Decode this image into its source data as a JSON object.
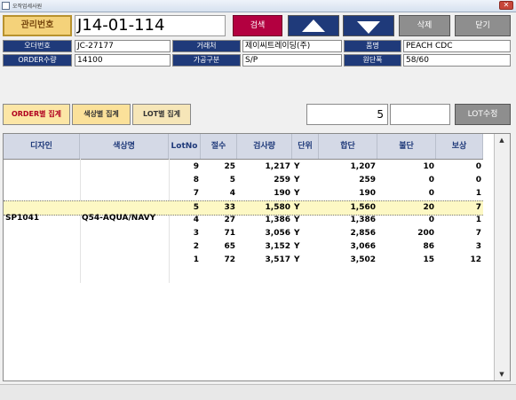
{
  "window": {
    "title": "오작업세사원"
  },
  "header": {
    "key_label": "관리번호",
    "key_value": "J14-01-114",
    "search_label": "검색",
    "delete_label": "삭제",
    "close_label": "닫기"
  },
  "fields": {
    "order_no_label": "오더번호",
    "order_no": "JC-27177",
    "customer_label": "거래처",
    "customer": "제이씨트레이딩(주)",
    "item_label": "품명",
    "item": "PEACH CDC",
    "order_qty_label": "ORDER수량",
    "order_qty": "14100",
    "process_label": "가공구분",
    "process": "S/P",
    "width_label": "원단폭",
    "width": "58/60"
  },
  "tabs": {
    "order_sum": "ORDER별 집계",
    "color_sum": "색상별 집계",
    "lot_sum": "LOT별 집계"
  },
  "lot": {
    "value": "5",
    "edit_label": "LOT수정"
  },
  "grid": {
    "headers": [
      "디자인",
      "색상명",
      "LotNo",
      "절수",
      "검사량",
      "단위",
      "합단",
      "불단",
      "보상"
    ],
    "design": "SP1041",
    "color": "Q54-AQUA/NAVY",
    "rows": [
      {
        "lot": "9",
        "cuts": "25",
        "qty": "1,217",
        "unit": "Y",
        "sum": "1,207",
        "defect": "10",
        "comp": "0"
      },
      {
        "lot": "8",
        "cuts": "5",
        "qty": "259",
        "unit": "Y",
        "sum": "259",
        "defect": "0",
        "comp": "0"
      },
      {
        "lot": "7",
        "cuts": "4",
        "qty": "190",
        "unit": "Y",
        "sum": "190",
        "defect": "0",
        "comp": "1"
      },
      {
        "lot": "5",
        "cuts": "33",
        "qty": "1,580",
        "unit": "Y",
        "sum": "1,560",
        "defect": "20",
        "comp": "7"
      },
      {
        "lot": "4",
        "cuts": "27",
        "qty": "1,386",
        "unit": "Y",
        "sum": "1,386",
        "defect": "0",
        "comp": "1"
      },
      {
        "lot": "3",
        "cuts": "71",
        "qty": "3,056",
        "unit": "Y",
        "sum": "2,856",
        "defect": "200",
        "comp": "7"
      },
      {
        "lot": "2",
        "cuts": "65",
        "qty": "3,152",
        "unit": "Y",
        "sum": "3,066",
        "defect": "86",
        "comp": "3"
      },
      {
        "lot": "1",
        "cuts": "72",
        "qty": "3,517",
        "unit": "Y",
        "sum": "3,502",
        "defect": "15",
        "comp": "12"
      }
    ]
  },
  "colors": {
    "accent": "#1f3a7a",
    "search": "#b30040",
    "selected_row": "#fdf8c4"
  },
  "icons": {
    "up": "triangle-up-icon",
    "down": "triangle-down-icon",
    "close": "close-icon"
  }
}
